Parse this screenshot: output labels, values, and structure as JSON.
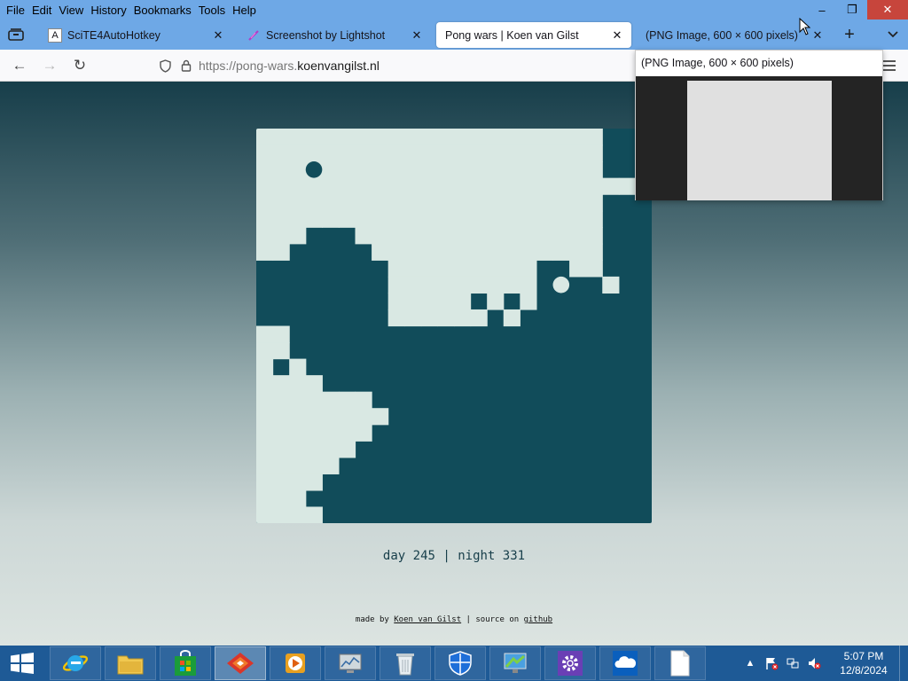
{
  "menu": [
    "File",
    "Edit",
    "View",
    "History",
    "Bookmarks",
    "Tools",
    "Help"
  ],
  "window_controls": {
    "minimize": "–",
    "restore": "❐",
    "close": "✕"
  },
  "tabs": [
    {
      "title": "SciTE4AutoHotkey",
      "favicon": "A",
      "close": "✕"
    },
    {
      "title": "Screenshot by Lightshot",
      "favicon": "feather",
      "close": "✕"
    },
    {
      "title": "Pong wars | Koen van Gilst",
      "favicon": "",
      "close": "✕"
    },
    {
      "title": "(PNG Image, 600 × 600 pixels)",
      "favicon": "",
      "close": "✕"
    }
  ],
  "toolbar": {
    "new_tab": "+",
    "list_tabs": "⌄"
  },
  "nav": {
    "back": "←",
    "forward": "→",
    "reload": "↻"
  },
  "url": {
    "prefix": "https://pong-wars.",
    "host": "koenvangilst.nl"
  },
  "preview": {
    "title": "(PNG Image, 600 × 600 pixels)"
  },
  "game": {
    "colors": {
      "day": "#d9e8e3",
      "night": "#114c5a"
    },
    "grid_size": 24,
    "day_ball_cell": [
      3,
      2
    ],
    "night_ball_cell": [
      18,
      9
    ],
    "day_rows": [
      "xxxxxxxxxxxxxxxxxxxxx...",
      "xxxxxxxxxxxxxxxxxxxxx...",
      "xxxxxxxxxxxxxxxxxxxxx...",
      "xxxxxxxxxxxxxxxxxxxxxxx.",
      "xxxxxxxxxxxxxxxxxxxxx...",
      "xxxxxxxxxxxxxxxxxxxxx...",
      "xxx...xxxxxxxxxxxxxxx...",
      "xx.....xxxxxxxxxxxxxx...",
      "........xxxxxxxxx..xx...",
      "........xxxxxxxxx....x..",
      "........xxxxx.x.x.......",
      "........xxxxxx.x........",
      "........................",
      "..........................",
      "........................",
      "........................",
      "..........................",
      "........................",
      "........................",
      "........................",
      "........................",
      "........................",
      "........................",
      "........................"
    ],
    "left_day_rows": [
      "........................",
      "........................",
      "........................",
      "........................",
      "........................",
      "........................",
      "........................",
      "........................",
      "........................",
      "........................",
      "........................",
      "........................",
      "xx......................",
      "xx......................",
      "x.x.....................",
      "xxxx....................",
      "xxxxxxx.................",
      "xxxxxxxx................",
      "xxxxxxx.................",
      "xxxxxx..................",
      "xxxxx...................",
      "xxxx....................",
      "xxx.....................",
      "xxxx...................."
    ]
  },
  "score": {
    "text": "day 245 | night 331"
  },
  "footer": {
    "made_by": "made by",
    "author": "Koen van Gilst",
    "sep": "| source on",
    "github": "github"
  },
  "taskbar": {
    "apps": [
      "start-button",
      "internet-explorer",
      "file-explorer",
      "store",
      "firefox-like",
      "media-player",
      "monitor",
      "recycle",
      "defender",
      "remote-desktop",
      "settings",
      "onedrive",
      "blank-file"
    ]
  },
  "clock": {
    "time": "5:07 PM",
    "date": "12/8/2024"
  }
}
